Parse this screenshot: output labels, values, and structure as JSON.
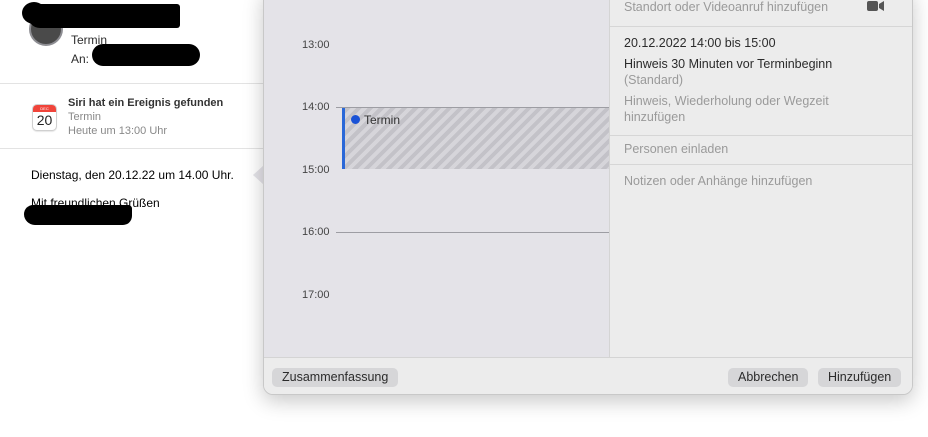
{
  "mail": {
    "subject": "Termin",
    "to_label": "An:",
    "siri": {
      "title": "Siri hat ein Ereignis gefunden",
      "event": "Termin",
      "time": "Heute um 13:00 Uhr",
      "icon_day": "20"
    },
    "body_line1": "Dienstag, den 20.12.22 um 14.00 Uhr.",
    "body_line2": "Mit freundlichen Grüßen"
  },
  "popover": {
    "hours": [
      "13:00",
      "14:00",
      "15:00",
      "16:00",
      "17:00"
    ],
    "event": {
      "title": "Termin",
      "color": "#2a68d8"
    },
    "details": {
      "location_placeholder": "Standort oder Videoanruf hinzufügen",
      "datetime": "20.12.2022  14:00 bis 15:00",
      "alert": "Hinweis 30 Minuten vor Terminbeginn",
      "alert_default": "(Standard)",
      "add_alert_line1": "Hinweis, Wiederholung oder Wegzeit",
      "add_alert_line2": "hinzufügen",
      "invite": "Personen einladen",
      "notes": "Notizen oder Anhänge hinzufügen"
    },
    "buttons": {
      "summary": "Zusammenfassung",
      "cancel": "Abbrechen",
      "add": "Hinzufügen"
    }
  }
}
